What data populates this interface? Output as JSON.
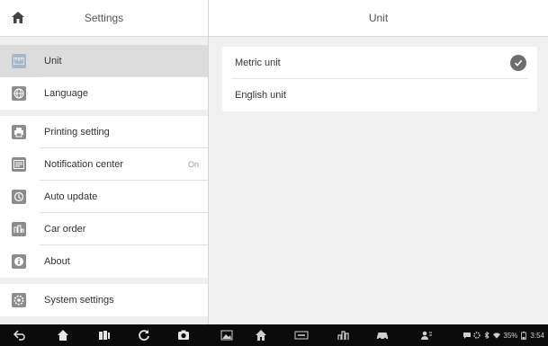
{
  "left_panel": {
    "title": "Settings",
    "groups": [
      [
        {
          "label": "Unit",
          "icon": "unit-icon",
          "selected": true
        },
        {
          "label": "Language",
          "icon": "globe-icon"
        }
      ],
      [
        {
          "label": "Printing setting",
          "icon": "printer-icon"
        },
        {
          "label": "Notification center",
          "icon": "message-icon",
          "value": "On"
        },
        {
          "label": "Auto update",
          "icon": "update-icon"
        },
        {
          "label": "Car order",
          "icon": "car-order-icon"
        },
        {
          "label": "About",
          "icon": "info-icon"
        }
      ],
      [
        {
          "label": "System settings",
          "icon": "gear-icon"
        }
      ]
    ]
  },
  "right_panel": {
    "title": "Unit",
    "options": [
      {
        "label": "Metric unit",
        "checked": true
      },
      {
        "label": "English unit",
        "checked": false
      }
    ]
  },
  "status_bar": {
    "time": "3:54",
    "battery": "35%"
  },
  "colors": {
    "selected_row": "#dcdcdc",
    "navbar": "#0b0b0b",
    "check": "#6e6e6e"
  }
}
